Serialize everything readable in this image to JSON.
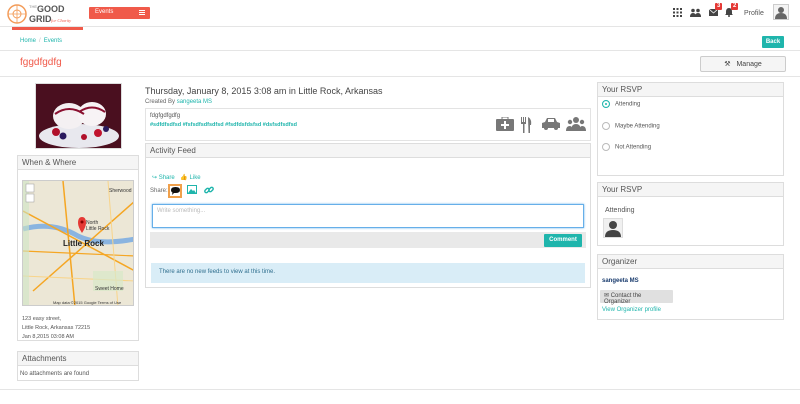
{
  "app": {
    "logo_text_1": "THE",
    "logo_text_2": "GOOD",
    "logo_text_3": "GRID",
    "logo_tagline": "for Charity"
  },
  "nav": {
    "events_label": "Events",
    "messages_count": "3",
    "notifications_count": "2",
    "profile_label": "Profile"
  },
  "breadcrumb": {
    "home": "Home",
    "current": "Events"
  },
  "header": {
    "back_label": "Back",
    "title": "fggdfgdfg",
    "manage_label": "Manage"
  },
  "event": {
    "date_line": "Thursday, January 8, 2015 3:08 am in Little Rock, Arkansas",
    "created_by_prefix": "Created By",
    "created_by_name": "sangeeta MS",
    "description": "fdgfgdfgdfg",
    "tags": "#sdfdfsdfsd #fsfsdfsdfsdfsd #fsdfdsfdsfsd #dsfsdfsdfsd"
  },
  "when_where": {
    "title": "When & Where",
    "address_line1": "123 easy street,",
    "address_line2": "Little Rock, Arkansas 72215",
    "address_line3": "Jan 8,2015 03:08 AM",
    "map_city": "Little Rock",
    "map_labels": [
      "Sherwood",
      "North Little Rock",
      "Sweet Home"
    ],
    "map_footer": "Map data ©2015 Google   Terms of Use"
  },
  "attachments": {
    "title": "Attachments",
    "empty_text": "No attachments are found"
  },
  "feed": {
    "title": "Activity Feed",
    "share_label": "Share",
    "like_label": "Like",
    "share_prefix": "Share:",
    "placeholder": "Write something...",
    "comment_label": "Comment",
    "empty_text": "There are no new feeds to view at this time."
  },
  "rsvp": {
    "title": "Your RSVP",
    "options": [
      "Attending",
      "Maybe Attending",
      "Not Attending"
    ],
    "selected": "Attending",
    "status_title": "Your RSVP",
    "status_label": "Attending"
  },
  "organizer": {
    "title": "Organizer",
    "name": "sangeeta MS",
    "contact_label": "Contact the Organizer",
    "profile_link": "View Organizer profile"
  },
  "colors": {
    "accent": "#1fb5ac",
    "brand": "#f05a4a",
    "info_bg": "#d9edf7"
  }
}
